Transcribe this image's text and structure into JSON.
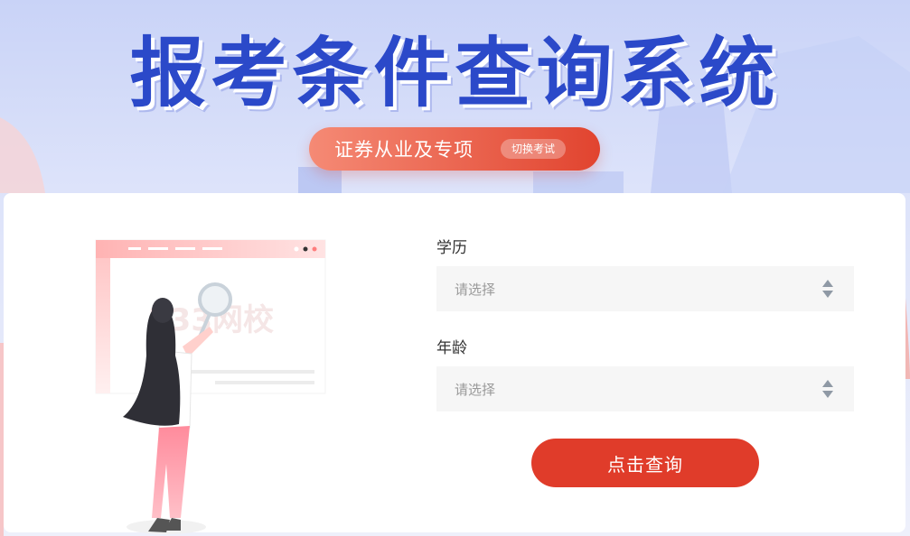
{
  "banner": {
    "title": "报考条件查询系统"
  },
  "exam_switch": {
    "current_exam": "证券从业及专项",
    "switch_label": "切换考试"
  },
  "form": {
    "education": {
      "label": "学历",
      "placeholder": "请选择"
    },
    "age": {
      "label": "年龄",
      "placeholder": "请选择"
    },
    "submit_label": "点击查询"
  },
  "illustration": {
    "watermark": "233网校"
  },
  "colors": {
    "title_blue": "#2b49c9",
    "accent_red": "#e03c2a",
    "pill_gradient_start": "#f58a75",
    "pill_gradient_end": "#e1442f"
  }
}
